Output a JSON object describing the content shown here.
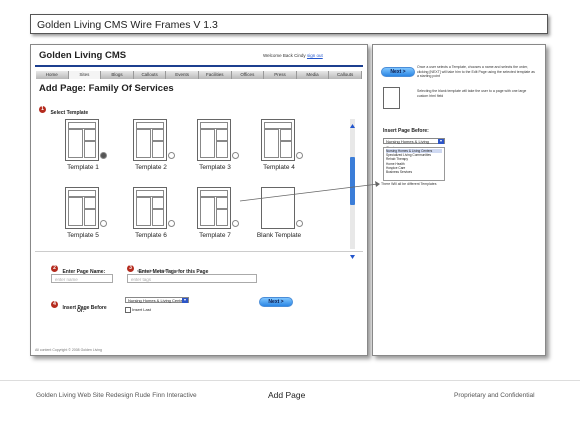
{
  "doc_title": "Golden Living CMS Wire Frames V 1.3",
  "header": {
    "logo": "Golden Living CMS",
    "welcome": "Welcome Back Cindy",
    "signout": "sign out"
  },
  "nav": {
    "tabs": [
      "Home",
      "Sites",
      "Blogs",
      "Callouts",
      "Events",
      "Facilities",
      "Offices",
      "Press",
      "Media",
      "Callouts"
    ],
    "active_index": 1
  },
  "page_heading": "Add Page: Family Of Services",
  "step1": {
    "num": "1",
    "label": "Select Template"
  },
  "templates": [
    {
      "name": "Template 1",
      "selected": true
    },
    {
      "name": "Template 2",
      "selected": false
    },
    {
      "name": "Template 3",
      "selected": false
    },
    {
      "name": "Template 4",
      "selected": false
    },
    {
      "name": "Template 5",
      "selected": false
    },
    {
      "name": "Template 6",
      "selected": false
    },
    {
      "name": "Template 7",
      "selected": false
    },
    {
      "name": "Blank Template",
      "selected": false
    }
  ],
  "step2": {
    "num": "2",
    "label": "Enter Page Name:",
    "placeholder": "enter name"
  },
  "step3": {
    "num": "3",
    "label": "Enter Meta Tags for this Page",
    "sublabel": "separating, delimited, etc.",
    "placeholder": "enter tags"
  },
  "step4": {
    "num": "4",
    "label": "Insert Page Before",
    "select_value": "Nursing Homes & Living Centers",
    "or_label": "Or:",
    "insert_last": "Insert Last"
  },
  "next_label": "Next >",
  "copyright": "All content Copyright © 2008 Golden Living",
  "side": {
    "next_label": "Next >",
    "next_note": "Once a user selects a Template, chooses a name and selects the order, clicking [NEXT] will take him to the Edit Page using the selected template as a starting point",
    "blank_note": "Selecting the blank template will take the user to a page with one large custom html field",
    "insert_heading": "Insert Page Before:",
    "insert_selected": "Nursing Homes & Living Centers",
    "insert_options": [
      "Nursing Homes & Living Centers",
      "Specialized Living Communities",
      "Rehab Therapy",
      "Home Health",
      "Hospice Care",
      "Business Services"
    ],
    "templates_note": "There Will all be different Templates"
  },
  "footer": {
    "left": "Golden Living Web Site Redesign   Rude Finn Interactive",
    "center": "Add Page",
    "right": "Proprietary and Confidential"
  },
  "colors": {
    "step_badge": "#b52b1e",
    "nav_rule": "#1c3f8f",
    "button": "#2b86e4"
  }
}
